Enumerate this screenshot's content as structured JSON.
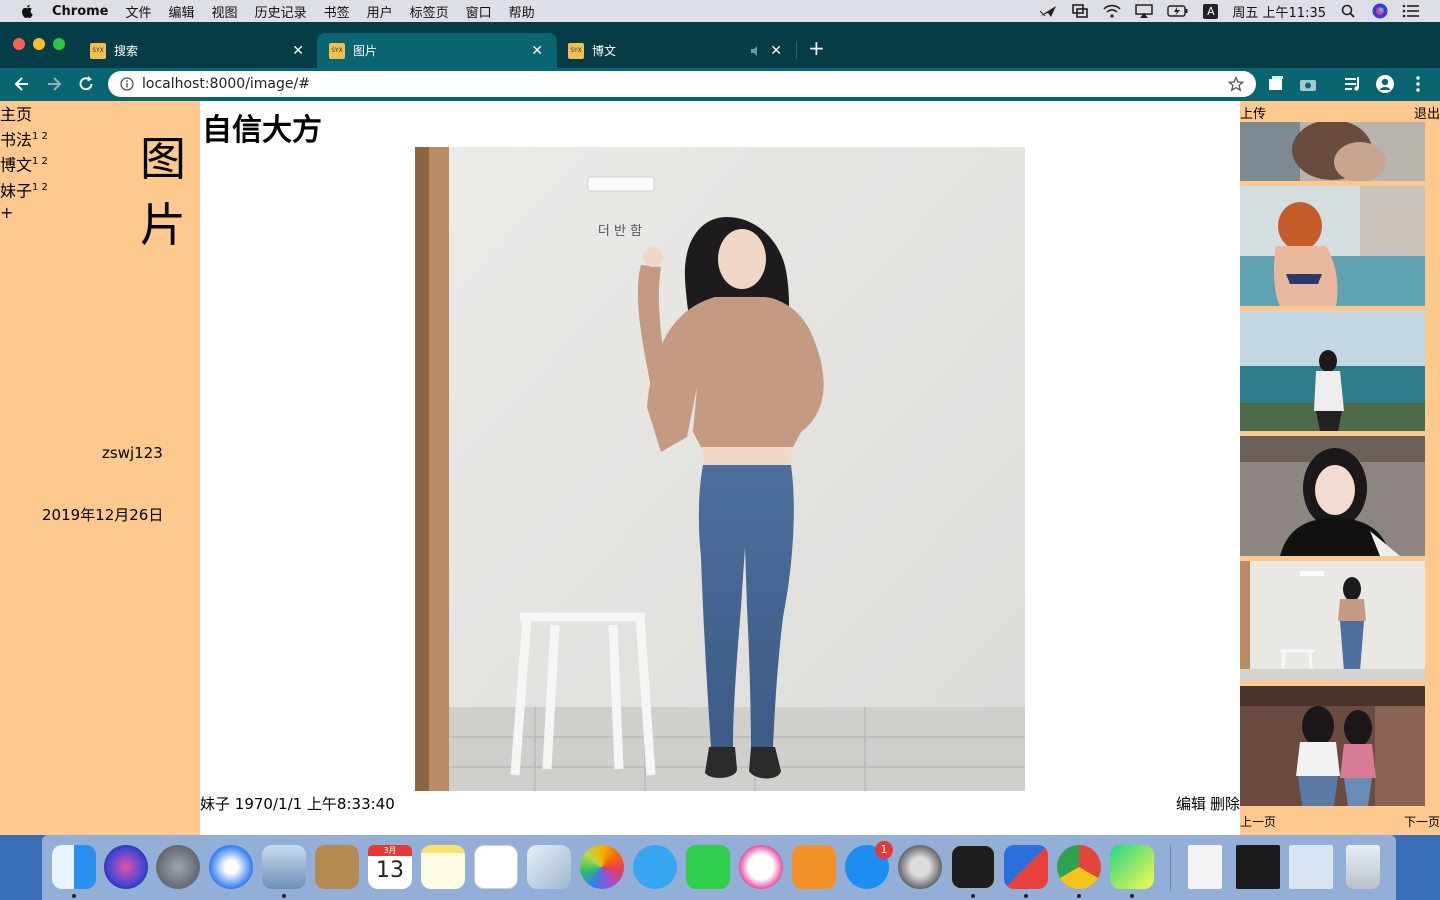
{
  "menubar": {
    "app": "Chrome",
    "items": [
      "文件",
      "编辑",
      "视图",
      "历史记录",
      "书签",
      "用户",
      "标签页",
      "窗口",
      "帮助"
    ],
    "clock": "周五 上午11:35",
    "input_method": "A"
  },
  "tabs": [
    {
      "favicon": "SYX",
      "label": "搜索"
    },
    {
      "favicon": "SYX",
      "label": "图片"
    },
    {
      "favicon": "SYX",
      "label": "博文"
    }
  ],
  "close_glyph": "✕",
  "new_tab": "+",
  "address": "localhost:8000/image/#",
  "sidebar": {
    "nav": [
      {
        "label": "主页",
        "sup": ""
      },
      {
        "label": "书法",
        "sup": "1 2"
      },
      {
        "label": "博文",
        "sup": "1 2"
      },
      {
        "label": "妹子",
        "sup": "1 2"
      }
    ],
    "add": "+",
    "section_title": "图片",
    "username": "zswj123",
    "date": "2019年12月26日"
  },
  "content": {
    "title": "自信大方",
    "photo_sign": "더 반 함",
    "category": "妹子",
    "timestamp": "1970/1/1 上午8:33:40",
    "edit": "编辑",
    "delete": "删除"
  },
  "rightbar": {
    "upload": "上传",
    "logout": "退出",
    "prev": "上一页",
    "next": "下一页"
  },
  "dock": {
    "calendar_month": "3月",
    "calendar_day": "13",
    "appstore_badge": "1"
  },
  "colors": {
    "sidebar": "#fdc98e",
    "browser_dark": "#053c46",
    "browser_teal": "#0a6573"
  }
}
